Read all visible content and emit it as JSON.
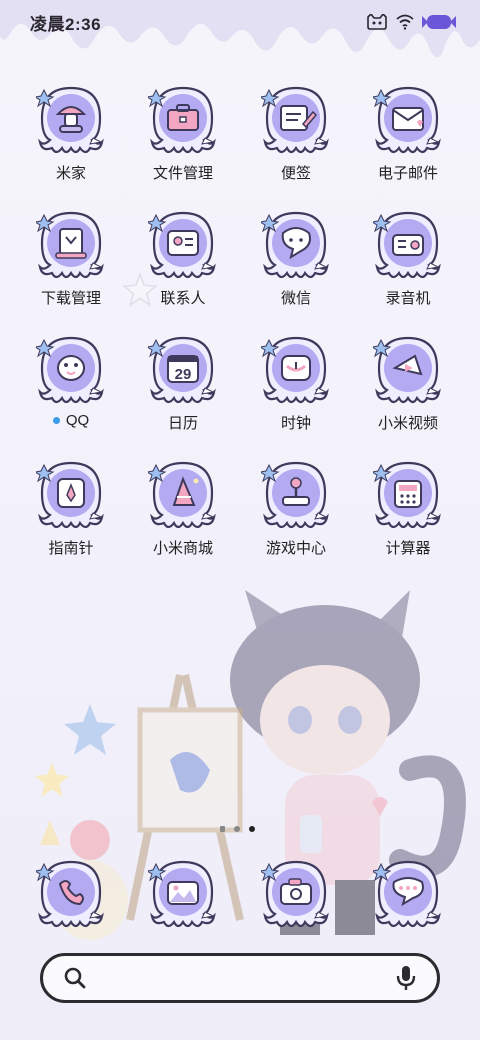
{
  "status": {
    "time": "凌晨2:36",
    "battery_color": "#6a57d8"
  },
  "apps": [
    {
      "id": "mijia",
      "label": "米家",
      "icon": "mushroom-icon"
    },
    {
      "id": "files",
      "label": "文件管理",
      "icon": "toolbox-icon"
    },
    {
      "id": "notes",
      "label": "便签",
      "icon": "note-pen-icon"
    },
    {
      "id": "email",
      "label": "电子邮件",
      "icon": "envelope-icon"
    },
    {
      "id": "downloads",
      "label": "下载管理",
      "icon": "download-card-icon"
    },
    {
      "id": "contacts",
      "label": "联系人",
      "icon": "contact-card-icon"
    },
    {
      "id": "wechat",
      "label": "微信",
      "icon": "chat-bubble-icon"
    },
    {
      "id": "recorder",
      "label": "录音机",
      "icon": "radio-icon"
    },
    {
      "id": "qq",
      "label": "QQ",
      "icon": "penguin-icon",
      "badge": true
    },
    {
      "id": "calendar",
      "label": "日历",
      "icon": "calendar-icon",
      "day": "29"
    },
    {
      "id": "clock",
      "label": "时钟",
      "icon": "clock-icon"
    },
    {
      "id": "video",
      "label": "小米视频",
      "icon": "play-icon"
    },
    {
      "id": "compass",
      "label": "指南针",
      "icon": "compass-icon"
    },
    {
      "id": "store",
      "label": "小米商城",
      "icon": "party-hat-icon"
    },
    {
      "id": "games",
      "label": "游戏中心",
      "icon": "joystick-icon"
    },
    {
      "id": "calculator",
      "label": "计算器",
      "icon": "calculator-icon"
    }
  ],
  "dock": [
    {
      "id": "phone",
      "icon": "phone-icon"
    },
    {
      "id": "gallery",
      "icon": "gallery-icon"
    },
    {
      "id": "camera",
      "icon": "camera-icon"
    },
    {
      "id": "messages",
      "icon": "message-bubble-icon"
    }
  ],
  "pager": {
    "pages": 3,
    "current": 3
  },
  "search": {
    "left_icon": "search-icon",
    "right_icon": "microphone-icon"
  }
}
